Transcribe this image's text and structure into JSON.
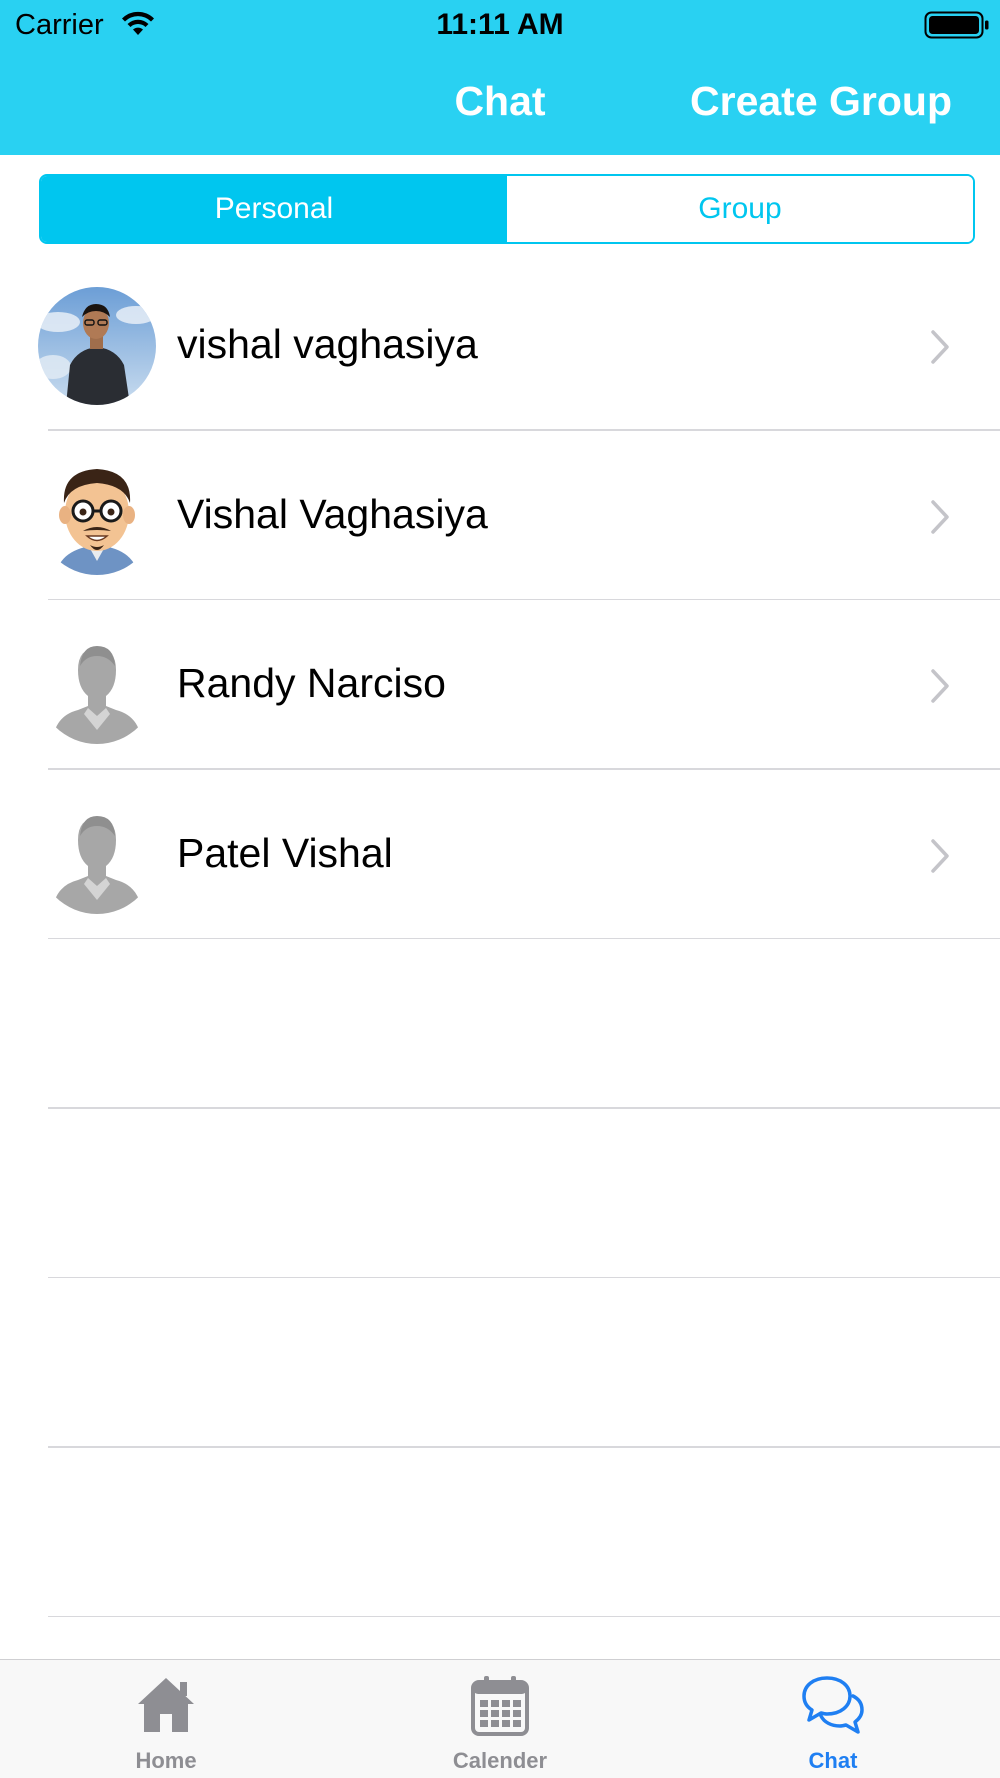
{
  "status_bar": {
    "carrier": "Carrier",
    "time": "11:11 AM"
  },
  "nav": {
    "title": "Chat",
    "create_group": "Create Group",
    "background_color": "#29d1f2"
  },
  "segments": {
    "selected": "Personal",
    "options": [
      "Personal",
      "Group"
    ],
    "accent_color": "#00c6ef"
  },
  "contacts": [
    {
      "name": "vishal vaghasiya",
      "avatar": "photo-avatar"
    },
    {
      "name": "Vishal Vaghasiya",
      "avatar": "cartoon-avatar"
    },
    {
      "name": "Randy Narciso",
      "avatar": "default-person-avatar"
    },
    {
      "name": "Patel Vishal",
      "avatar": "default-person-avatar"
    }
  ],
  "tabbar": {
    "items": [
      {
        "label": "Home",
        "icon": "home-icon",
        "active": false
      },
      {
        "label": "Calender",
        "icon": "calendar-icon",
        "active": false
      },
      {
        "label": "Chat",
        "icon": "chat-bubbles-icon",
        "active": true
      }
    ],
    "active_color": "#1f7ff2",
    "inactive_color": "#8e8e93"
  }
}
